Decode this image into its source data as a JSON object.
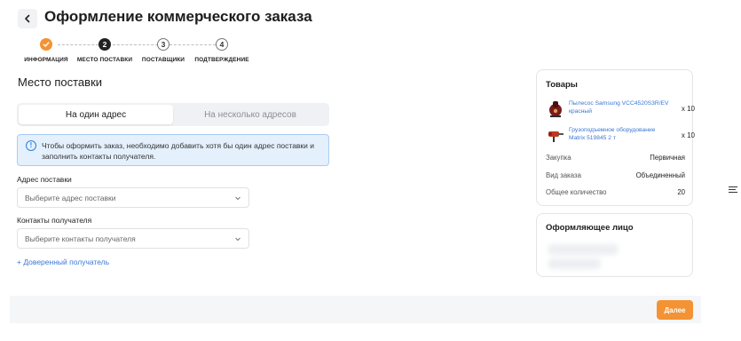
{
  "header": {
    "title": "Оформление коммерческого заказа"
  },
  "stepper": [
    {
      "number": "",
      "label": "ИНФОРМАЦИЯ",
      "state": "done"
    },
    {
      "number": "2",
      "label": "МЕСТО ПОСТАВКИ",
      "state": "current"
    },
    {
      "number": "3",
      "label": "ПОСТАВЩИКИ",
      "state": "todo"
    },
    {
      "number": "4",
      "label": "ПОДТВЕРЖДЕНИЕ",
      "state": "todo"
    }
  ],
  "delivery": {
    "title": "Место поставки",
    "tabs": [
      {
        "label": "На один адрес",
        "active": true
      },
      {
        "label": "На несколько адресов",
        "active": false
      }
    ],
    "info_line1": "Чтобы оформить заказ, необходимо добавить хотя бы один адрес поставки и",
    "info_line2": "заполнить контакты получателя.",
    "address_label": "Адрес поставки",
    "address_placeholder": "Выберите адрес поставки",
    "contacts_label": "Контакты получателя",
    "contacts_placeholder": "Выберите контакты получателя",
    "trusted_link": "+ Доверенный получатель"
  },
  "goods": {
    "title": "Товары",
    "products": [
      {
        "name_line1": "Пылесос Samsung VCC4520S3R/EV",
        "name_line2": "красный",
        "qty": "x 10"
      },
      {
        "name_line1": "Грузоподъемное оборудование",
        "name_line2": "Matrix 519845 2 т",
        "qty": "x 10"
      }
    ],
    "details": [
      {
        "key": "Закупка",
        "value": "Первичная"
      },
      {
        "key": "Вид заказа",
        "value": "Объединенный"
      },
      {
        "key": "Общее количество",
        "value": "20"
      }
    ]
  },
  "person": {
    "title": "Оформляющее лицо"
  },
  "footer": {
    "next_label": "Далее"
  },
  "colors": {
    "accent": "#f39333",
    "link": "#3a78d6",
    "info_bg": "#e4f0fc"
  },
  "icons": [
    "back-arrow-icon",
    "check-icon",
    "info-icon",
    "chevron-down-icon",
    "plus-icon",
    "vacuum-icon",
    "hoist-icon",
    "menu-icon"
  ]
}
